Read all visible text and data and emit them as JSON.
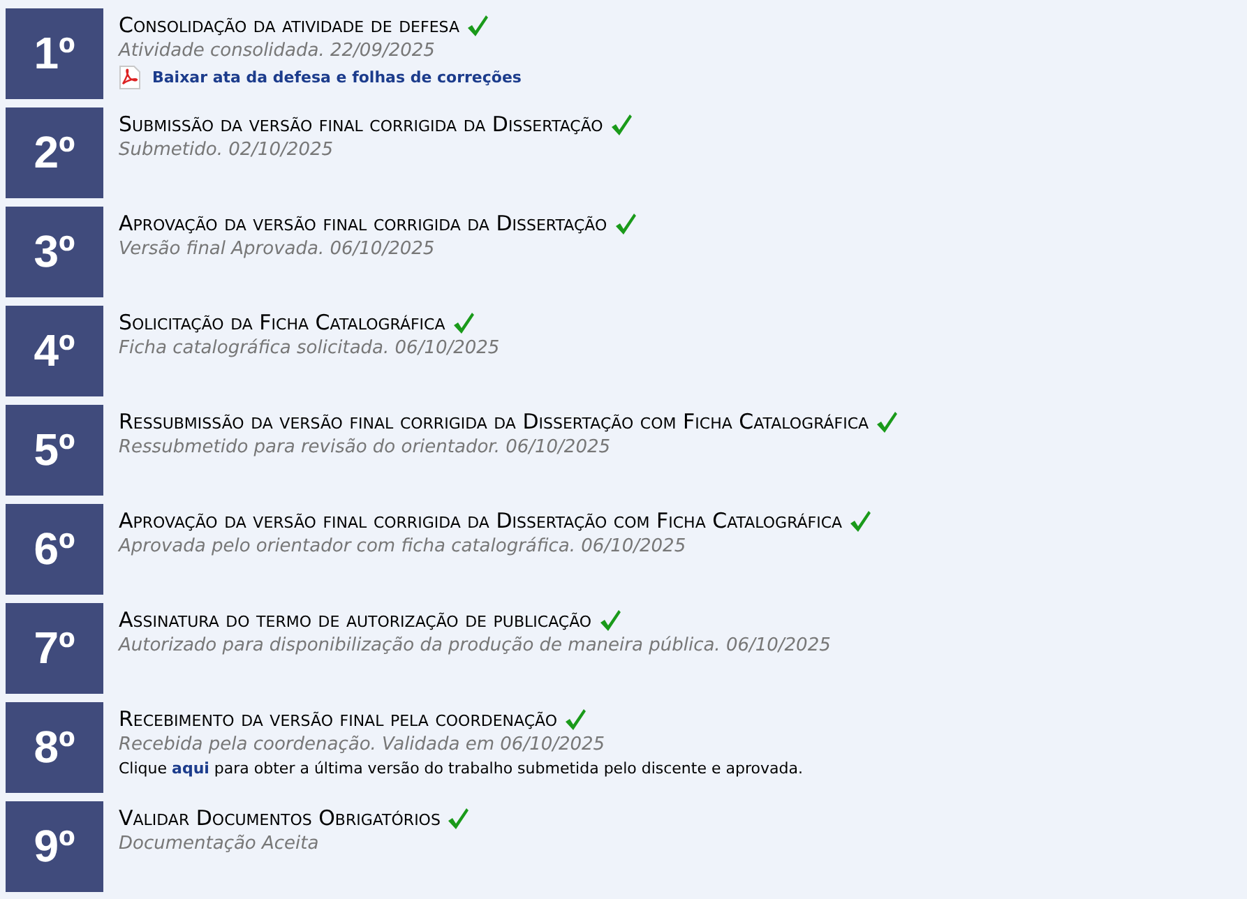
{
  "steps": [
    {
      "number": "1º",
      "title": "Consolidação da atividade de defesa",
      "done": true,
      "status": "Atividade consolidada. 22/09/2025",
      "download": "Baixar ata da defesa e folhas de correções"
    },
    {
      "number": "2º",
      "title": "Submissão da versão final corrigida da Dissertação",
      "done": true,
      "status": "Submetido. 02/10/2025"
    },
    {
      "number": "3º",
      "title": "Aprovação da versão final corrigida da Dissertação",
      "done": true,
      "status": "Versão final Aprovada. 06/10/2025"
    },
    {
      "number": "4º",
      "title": "Solicitação da Ficha Catalográfica",
      "done": true,
      "status": "Ficha catalográfica solicitada. 06/10/2025"
    },
    {
      "number": "5º",
      "title": "Ressubmissão da versão final corrigida da Dissertação com Ficha Catalográfica",
      "done": true,
      "status": "Ressubmetido para revisão do orientador. 06/10/2025"
    },
    {
      "number": "6º",
      "title": "Aprovação da versão final corrigida da Dissertação com Ficha Catalográfica",
      "done": true,
      "status": "Aprovada pelo orientador com ficha catalográfica. 06/10/2025"
    },
    {
      "number": "7º",
      "title": "Assinatura do termo de autorização de publicação",
      "done": true,
      "status": "Autorizado para disponibilização da produção de maneira pública. 06/10/2025"
    },
    {
      "number": "8º",
      "title": "Recebimento da versão final pela coordenação",
      "done": true,
      "status": "Recebida pela coordenação. Validada em 06/10/2025",
      "note": {
        "before": "Clique ",
        "link": "aqui",
        "after": " para obter a última versão do trabalho submetida pelo discente e aprovada."
      }
    },
    {
      "number": "9º",
      "title": "Validar Documentos Obrigatórios",
      "done": true,
      "status": "Documentação Aceita"
    }
  ]
}
